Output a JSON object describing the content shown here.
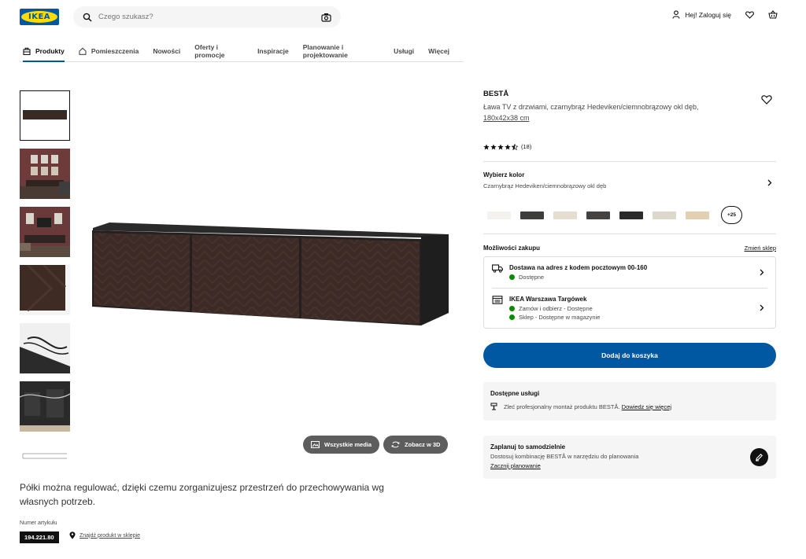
{
  "header": {
    "logo_text": "IKEA",
    "search_placeholder": "Czego szukasz?",
    "login_label": "Hej! Zaloguj się"
  },
  "nav": {
    "items": [
      {
        "label": "Produkty",
        "icon": "bag-icon",
        "active": true
      },
      {
        "label": "Pomieszczenia",
        "icon": "home-icon"
      },
      {
        "label": "Nowości"
      },
      {
        "label": "Oferty i promocje"
      },
      {
        "label": "Inspiracje"
      },
      {
        "label": "Planowanie i projektowanie"
      },
      {
        "label": "Usługi"
      },
      {
        "label": "Więcej"
      }
    ]
  },
  "media": {
    "all_media_label": "Wszystkie media",
    "view_3d_label": "Zobacz w 3D"
  },
  "product": {
    "name": "BESTÅ",
    "description": "Ława TV z drzwiami, czarnybrąz Hedeviken/ciemnobrązowy okl dęb,",
    "size": "180x42x38 cm",
    "rating_value": 4.5,
    "review_count": "(18)",
    "long_description": "Półki można regulować, dzięki czemu zorganizujesz przestrzeń do przechowywania wg własnych potrzeb.",
    "article_label": "Numer artykułu",
    "article_number": "194.221.80",
    "find_in_store": "Znajdź produkt w sklepie"
  },
  "color": {
    "title": "Wybierz kolor",
    "selected": "Czarnybrąz Hedeviken/ciemnobrązowy okl dęb",
    "swatches": [
      "#f4f2ee",
      "#3d3d3b",
      "#e5ddd0",
      "#454341",
      "#2b2b2b",
      "#ddd8cb",
      "#e3cfb2"
    ],
    "more_label": "+25"
  },
  "purchase": {
    "title": "Możliwości zakupu",
    "change_store": "Zmień sklep",
    "delivery_title": "Dostawa na adres z kodem pocztowym 00-160",
    "delivery_status": "Dostępne",
    "store_title": "IKEA Warszawa Targówek",
    "store_line1": "Zamów i odbierz - Dostępne",
    "store_line2": "Sklep - Dostępne w magazynie",
    "status_color": "#0a8a00"
  },
  "add_to_cart": "Dodaj do koszyka",
  "services": {
    "title": "Dostępne usługi",
    "text": "Zleć profesjonalny montaż produktu BESTÅ.",
    "link": "Dowiedz się więcej"
  },
  "plan": {
    "title": "Zaplanuj to samodzielnie",
    "text": "Dostosuj kombinację BESTÅ w narzędziu do planowania",
    "link": "Zacznij planowanie"
  },
  "colors": {
    "brand_blue": "#0058a3",
    "brand_yellow": "#ffdb00"
  }
}
